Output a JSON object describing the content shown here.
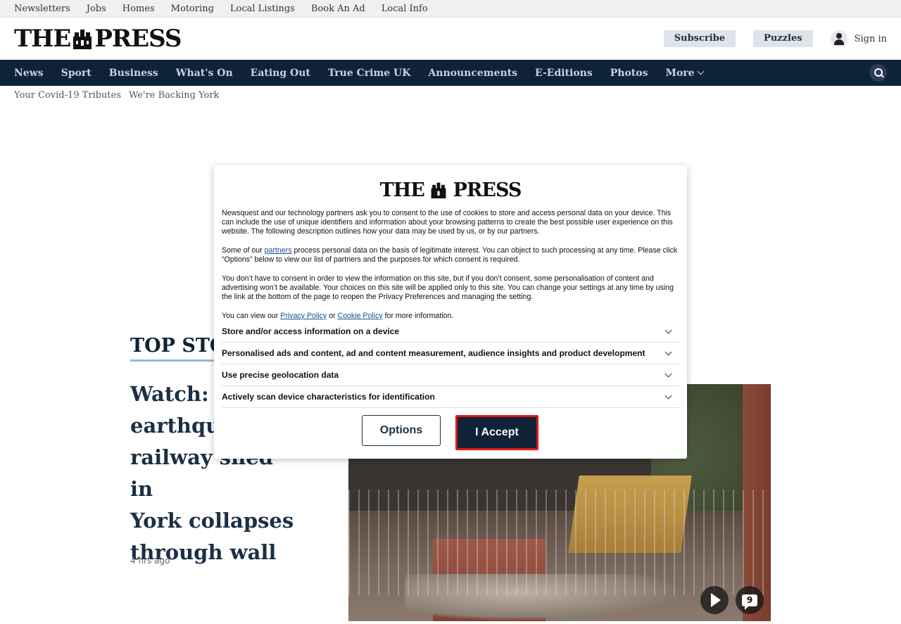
{
  "utility_nav": [
    "Newsletters",
    "Jobs",
    "Homes",
    "Motoring",
    "Local Listings",
    "Book An Ad",
    "Local Info"
  ],
  "masthead": {
    "logo_left": "THE",
    "logo_right": "PRESS",
    "subscribe": "Subscribe",
    "puzzles": "Puzzles",
    "signin": "Sign in"
  },
  "main_nav": [
    "News",
    "Sport",
    "Business",
    "What's On",
    "Eating Out",
    "True Crime UK",
    "Announcements",
    "E-Editions",
    "Photos"
  ],
  "main_nav_more": "More",
  "sub_links": [
    "Your Covid-19 Tributes",
    "We're Backing York"
  ],
  "top_stories": {
    "heading": "TOP STO",
    "headline": "Watch: 'I... earthqua... railway shed in York collapses through wall",
    "headline_lines": [
      "Watch: 'I",
      "earthqua",
      "railway shed in",
      "York collapses",
      "through wall"
    ],
    "time": "4 hrs ago",
    "comment_count": "9"
  },
  "consent": {
    "logo_left": "THE",
    "logo_right": "PRESS",
    "para1": "Newsquest and our technology partners ask you to consent to the use of cookies to store and access personal data on your device. This can include the use of unique identifiers and information about your browsing patterns to create the best possible user experience on this website. The following description outlines how your data may be used by us, or by our partners.",
    "para2_before": "Some of our ",
    "para2_link": "partners",
    "para2_after": " process personal data on the basis of legitimate interest. You can object to such processing at any time. Please click “Options” below to view our list of partners and the purposes for which consent is required.",
    "para3": "You don’t have to consent in order to view the information on this site, but if you don’t consent, some personalisation of content and advertising won’t be available. Your choices on this site will be applied only to this site. You can change your settings at any time by using the link at the bottom of the page to reopen the Privacy Preferences and managing the setting.",
    "para4_before": "You can view our ",
    "privacy_link": "Privacy Policy",
    "para4_mid": " or ",
    "cookie_link": "Cookie Policy",
    "para4_after": " for more information.",
    "purposes": [
      "Store and/or access information on a device",
      "Personalised ads and content, ad and content measurement, audience insights and product development",
      "Use precise geolocation data",
      "Actively scan device characteristics for identification"
    ],
    "options_label": "Options",
    "accept_label": "I Accept"
  },
  "colors": {
    "nav_bg": "#0e2238",
    "accept_border": "#e01818",
    "pill_bg": "#dfe4ea"
  }
}
